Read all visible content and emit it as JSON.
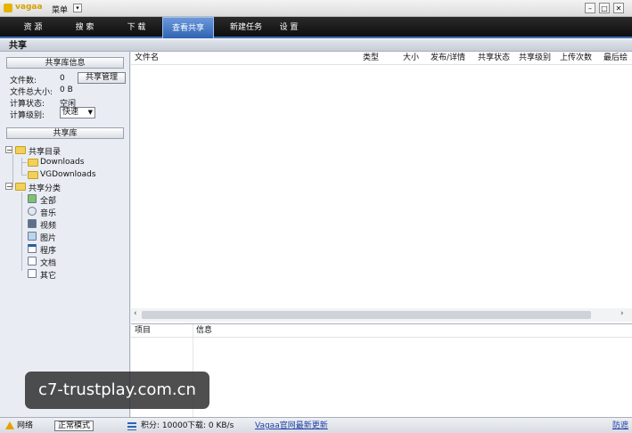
{
  "window": {
    "app_logo_text": "vagaa",
    "menu_label": "菜单",
    "controls": {
      "minimize": "–",
      "maximize": "□",
      "close": "✕"
    }
  },
  "nav": {
    "tabs": [
      {
        "label": "资 源"
      },
      {
        "label": "搜 索"
      },
      {
        "label": "下 载"
      },
      {
        "label": "查看共享"
      },
      {
        "label": "新建任务"
      },
      {
        "label": "设 置"
      }
    ],
    "active_index": 3
  },
  "section_title": "共享",
  "left": {
    "info_header": "共享库信息",
    "file_count_label": "文件数:",
    "file_count_value": "0",
    "total_size_label": "文件总大小:",
    "total_size_value": "0 B",
    "calc_state_label": "计算状态:",
    "calc_state_value": "空闲",
    "calc_level_label": "计算级别:",
    "calc_level_value": "快速",
    "manage_button": "共享管理",
    "library_header": "共享库",
    "tree": {
      "dir_root": "共享目录",
      "dirs": [
        "Downloads",
        "VGDownloads"
      ],
      "cat_root": "共享分类",
      "categories": [
        {
          "label": "全部",
          "icon": "all-files-icon"
        },
        {
          "label": "音乐",
          "icon": "music-icon"
        },
        {
          "label": "视频",
          "icon": "video-icon"
        },
        {
          "label": "图片",
          "icon": "image-icon"
        },
        {
          "label": "程序",
          "icon": "program-icon"
        },
        {
          "label": "文档",
          "icon": "document-icon"
        },
        {
          "label": "其它",
          "icon": "other-icon"
        }
      ]
    }
  },
  "file_table": {
    "columns": [
      "文件名",
      "类型",
      "大小",
      "发布/详情",
      "共享状态",
      "共享级别",
      "上传次数",
      "最后绘"
    ],
    "rows": []
  },
  "info_table": {
    "columns": [
      "项目",
      "信息"
    ],
    "rows": []
  },
  "watermark": "c7-trustplay.com.cn",
  "status": {
    "network": "网络",
    "mode": "正常模式",
    "points": "积分: 10000",
    "download": "下载: 0 KB/s",
    "update_link": "Vagaa官网最新更新",
    "right_link": "防遮"
  },
  "colors": {
    "nav_bg": "#111111",
    "nav_active": "#3f74c4",
    "link": "#1f3fa8",
    "folder": "#f2d15a"
  }
}
